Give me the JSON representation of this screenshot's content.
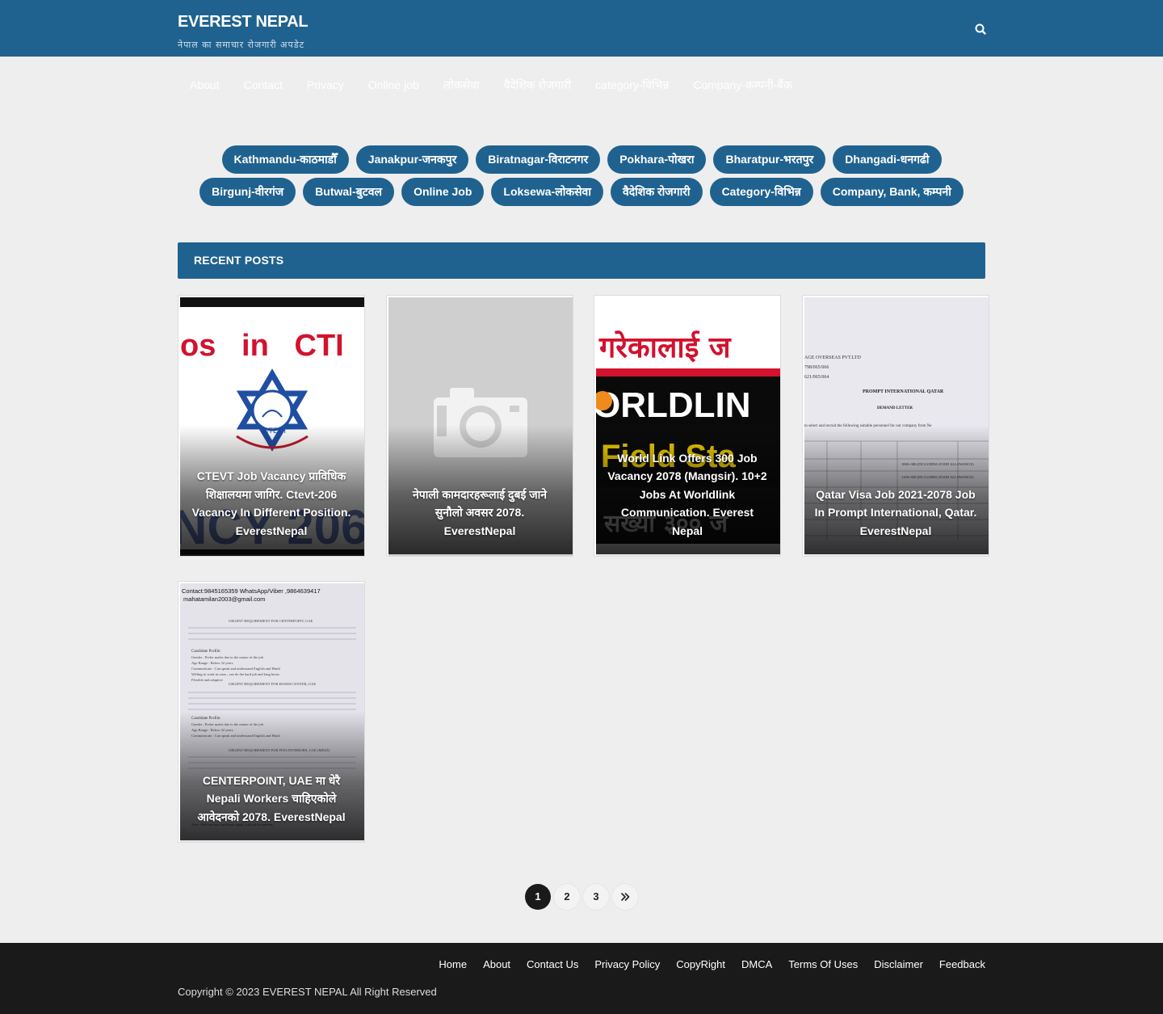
{
  "header": {
    "site_title": "EVEREST NEPAL",
    "tagline": "नेपाल का समाचार रोजगारी अपडेट",
    "search_icon": "search-icon"
  },
  "menu": [
    {
      "label": "About"
    },
    {
      "label": "Contact"
    },
    {
      "label": "Privacy"
    },
    {
      "label": "Online job"
    },
    {
      "label": "लोकसेवा"
    },
    {
      "label": "वैदेशिक रोजगारी"
    },
    {
      "label": "category-विभिन्न"
    },
    {
      "label": "Company-कम्पनी-बैंक"
    }
  ],
  "categories": [
    {
      "label": "Kathmandu-काठमाडौँ"
    },
    {
      "label": "Janakpur-जनकपुर"
    },
    {
      "label": "Biratnagar-विराटनगर"
    },
    {
      "label": "Pokhara-पोखरा"
    },
    {
      "label": "Bharatpur-भरतपुर"
    },
    {
      "label": "Dhangadi-धनगढी"
    },
    {
      "label": "Birgunj-वीरगंज"
    },
    {
      "label": "Butwal-बुटवल"
    },
    {
      "label": "Online Job"
    },
    {
      "label": "Loksewa-लोकसेवा"
    },
    {
      "label": "वैदेशिक रोजगारी"
    },
    {
      "label": "Category-विभिन्न"
    },
    {
      "label": "Company, Bank, कम्पनी"
    }
  ],
  "recent_posts": {
    "title": "RECENT POSTS",
    "posts": [
      {
        "title": "CTEVT Job Vacancy प्राविधिक शिक्षालयमा जागिर. Ctevt-206 Vacancy In Different Position. EverestNepal",
        "image": "ctevt-thumbnail"
      },
      {
        "title": "नेपाली कामदारहरूलाई दुबई जाने सुनौलो अवसर 2078. EverestNepal",
        "image": "camera-placeholder-icon"
      },
      {
        "title": "World Link Offers 300 Job Vacancy 2078 (Mangsir). 10+2 Jobs At Worldlink Communication. Everest Nepal",
        "image": "worldlink-thumbnail"
      },
      {
        "title": "Qatar Visa Job 2021-2078 Job In Prompt International, Qatar. EverestNepal",
        "image": "demand-letter-thumbnail"
      },
      {
        "title": "CENTERPOINT, UAE मा धेरै Nepali Workers चाहिएकोले आवेदनको 2078. EverestNepal",
        "image": "centerpoint-demand-thumbnail"
      }
    ]
  },
  "pagination": {
    "pages": [
      "1",
      "2",
      "3"
    ],
    "current": "1",
    "next_icon": "double-chevron-right-icon"
  },
  "footer": {
    "links": [
      {
        "label": "Home"
      },
      {
        "label": "About"
      },
      {
        "label": "Contact Us"
      },
      {
        "label": "Privacy Policy"
      },
      {
        "label": "CopyRight"
      },
      {
        "label": "DMCA"
      },
      {
        "label": "Terms Of Uses"
      },
      {
        "label": "Disclaimer"
      },
      {
        "label": "Feedback"
      }
    ],
    "copyright": "Copyright © 2023 EVEREST NEPAL All Right Reserved"
  },
  "colors": {
    "primary": "#1f628f",
    "footer_bg": "#1a1a1a",
    "page_bg": "#eeeeee"
  }
}
